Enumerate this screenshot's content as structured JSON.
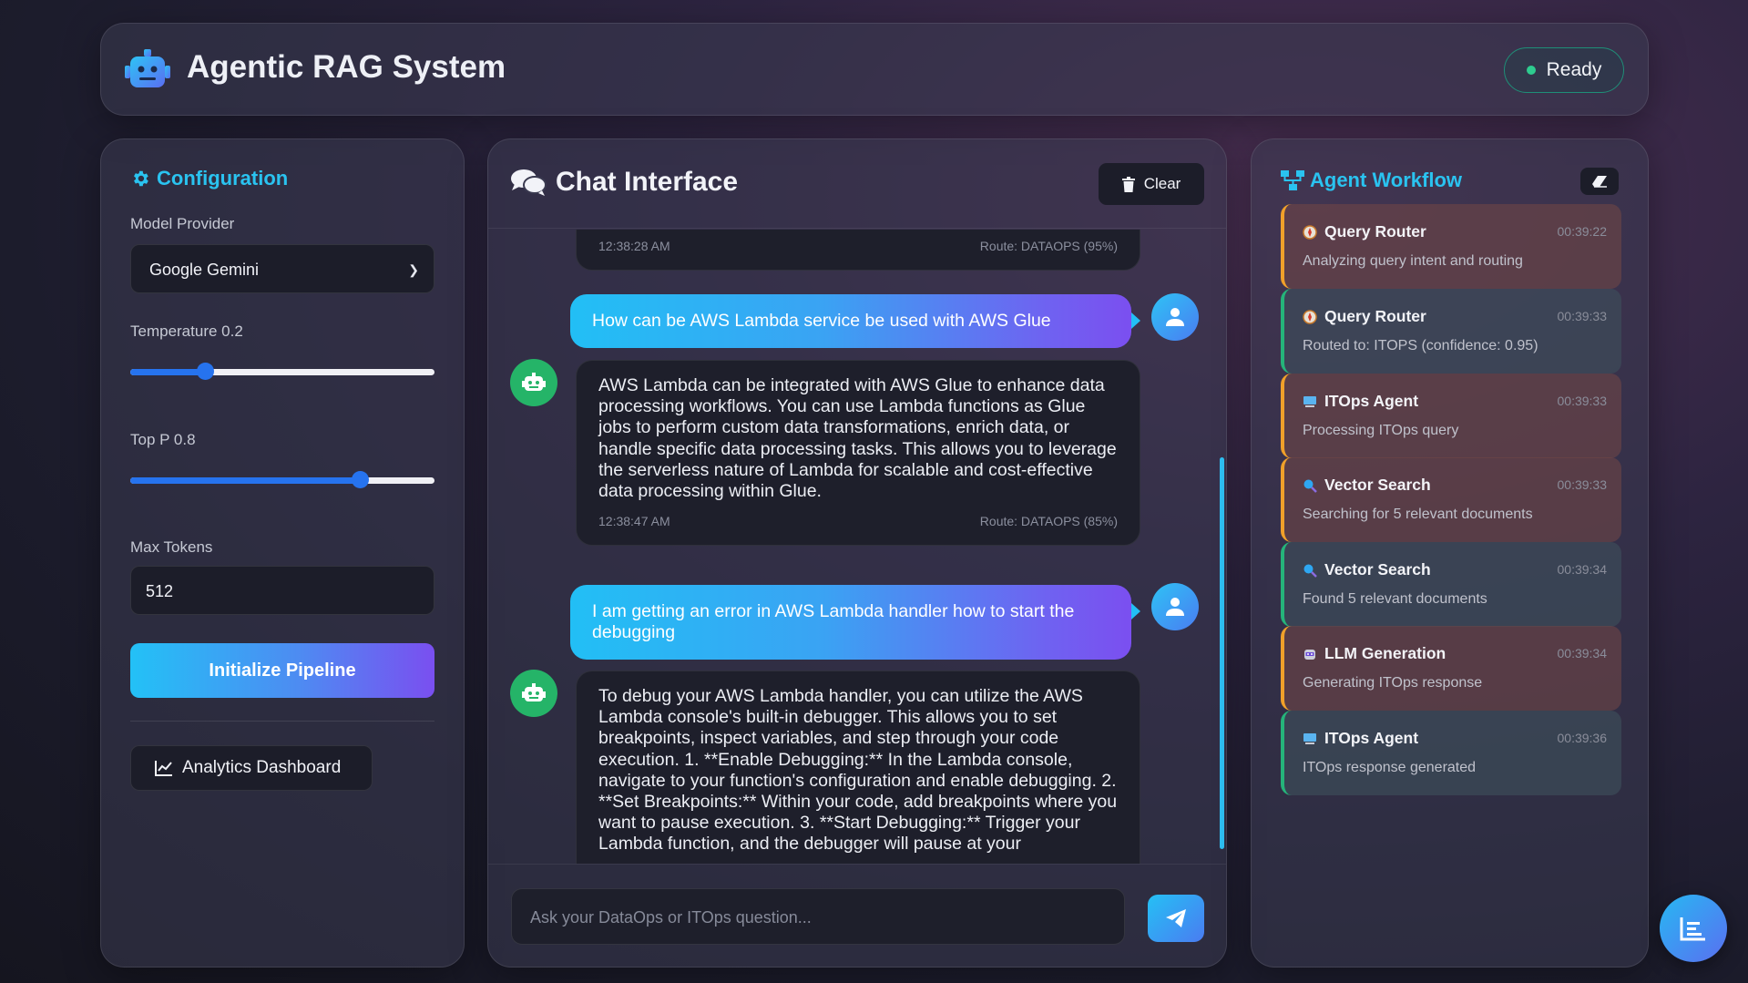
{
  "header": {
    "title": "Agentic RAG System",
    "status": "Ready"
  },
  "config": {
    "title": "Configuration",
    "model_provider_label": "Model Provider",
    "model_provider_value": "Google Gemini",
    "temperature_label": "Temperature 0.2",
    "temperature_value": 0.2,
    "top_p_label": "Top P 0.8",
    "top_p_value": 0.8,
    "max_tokens_label": "Max Tokens",
    "max_tokens_value": "512",
    "init_button": "Initialize Pipeline",
    "analytics_button": "Analytics Dashboard"
  },
  "chat": {
    "title": "Chat Interface",
    "clear_button": "Clear",
    "input_placeholder": "Ask your DataOps or ITOps question...",
    "messages": [
      {
        "role": "bot",
        "time": "12:38:28 AM",
        "route": "Route: DATAOPS (95%)"
      },
      {
        "role": "user",
        "text": "How can be AWS Lambda service be used with AWS Glue"
      },
      {
        "role": "bot",
        "text": "AWS Lambda can be integrated with AWS Glue to enhance data processing workflows. You can use Lambda functions as Glue jobs to perform custom data transformations, enrich data, or handle specific data processing tasks. This allows you to leverage the serverless nature of Lambda for scalable and cost-effective data processing within Glue.",
        "time": "12:38:47 AM",
        "route": "Route: DATAOPS (85%)"
      },
      {
        "role": "user",
        "text": "I am getting an error in AWS Lambda handler how to start the debugging"
      },
      {
        "role": "bot",
        "text": "To debug your AWS Lambda handler, you can utilize the AWS Lambda console's built-in debugger. This allows you to set breakpoints, inspect variables, and step through your code execution. 1. **Enable Debugging:** In the Lambda console, navigate to your function's configuration and enable debugging. 2. **Set Breakpoints:** Within your code, add breakpoints where you want to pause execution. 3. **Start Debugging:** Trigger your Lambda function, and the debugger will pause at your"
      }
    ]
  },
  "workflow": {
    "title": "Agent Workflow",
    "steps": [
      {
        "name": "Query Router",
        "time": "00:39:22",
        "desc": "Analyzing query intent and routing",
        "icon": "compass-icon",
        "status": "orange"
      },
      {
        "name": "Query Router",
        "time": "00:39:33",
        "desc": "Routed to: ITOPS (confidence: 0.95)",
        "icon": "compass-icon",
        "status": "green"
      },
      {
        "name": "ITOps Agent",
        "time": "00:39:33",
        "desc": "Processing ITOps query",
        "icon": "computer-icon",
        "status": "orange"
      },
      {
        "name": "Vector Search",
        "time": "00:39:33",
        "desc": "Searching for 5 relevant documents",
        "icon": "magnifier-icon",
        "status": "orange"
      },
      {
        "name": "Vector Search",
        "time": "00:39:34",
        "desc": "Found 5 relevant documents",
        "icon": "magnifier-icon",
        "status": "green"
      },
      {
        "name": "LLM Generation",
        "time": "00:39:34",
        "desc": "Generating ITOps response",
        "icon": "robot-icon",
        "status": "orange"
      },
      {
        "name": "ITOps Agent",
        "time": "00:39:36",
        "desc": "ITOps response generated",
        "icon": "computer-icon",
        "status": "green"
      }
    ]
  },
  "colors": {
    "accent": "#2ac3f0",
    "success": "#2ecc8f",
    "warning": "#f0a02a",
    "user_gradient_start": "#22bff5",
    "user_gradient_end": "#7b4ff0"
  }
}
